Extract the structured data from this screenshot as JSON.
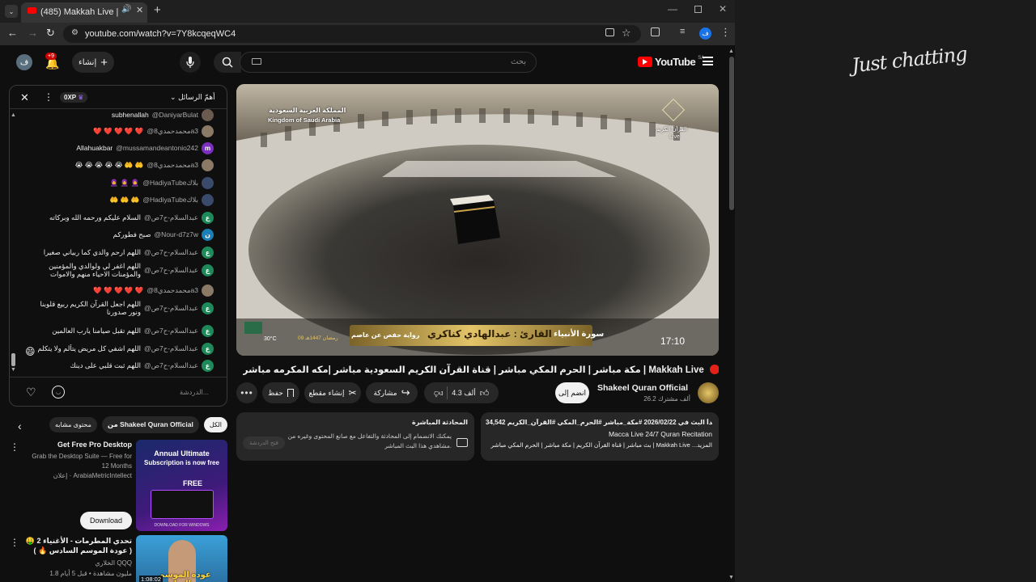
{
  "browser": {
    "tab_title": "(485) Makkah Live | مكة",
    "url": "youtube.com/watch?v=7Y8kcqeqWC4"
  },
  "header": {
    "logo": "YouTube",
    "region": "SA",
    "search_placeholder": "بحث",
    "create_label": "إنشاء",
    "notif_count": "+9",
    "avatar_letter": "ف"
  },
  "chat": {
    "header_title": "أهمّ الرسائل",
    "points": "0XP",
    "messages": [
      {
        "author": "@DaniyarBulat",
        "text": "subhenallah",
        "avatar": "",
        "color": "#6b5a4e"
      },
      {
        "author": "@محمدحمدي8a3",
        "text": "❤️ ❤️ ❤️ ❤️ ❤️",
        "avatar": "",
        "color": "#8a7a66"
      },
      {
        "author": "@mussamandeantonio242",
        "text": "Allahuakbar",
        "avatar": "m",
        "color": "#7b2fbe"
      },
      {
        "author": "@محمدحمدي8a3",
        "text": "😭 😭 😭 😭 😭 🤲 🤲",
        "avatar": "",
        "color": "#8a7a66"
      },
      {
        "author": "@HadiyaTubeبلاك",
        "text": "🧕 🧕 🧕",
        "avatar": "",
        "color": "#3a4a6a"
      },
      {
        "author": "@HadiyaTubeبلاك",
        "text": "🤲 🤲 🤲",
        "avatar": "",
        "color": "#3a4a6a"
      },
      {
        "author": "@عبدالسلام-ح7ص",
        "text": "السلام عليكم ورحمه الله وبركاته",
        "avatar": "ع",
        "color": "#1e8a5a"
      },
      {
        "author": "@Nour-d7z7w",
        "text": "صبح فطوركم",
        "avatar": "ن",
        "color": "#1a7fb5"
      },
      {
        "author": "@عبدالسلام-ح7ص",
        "text": "اللهم ارحم والدي كما ربياني صغيرا",
        "avatar": "ع",
        "color": "#1e8a5a"
      },
      {
        "author": "@عبدالسلام-ح7ص",
        "text": "اللهم اغفر لي ولوالدي والمؤمنين والمؤمنات الاحياء منهم والاموات",
        "avatar": "ع",
        "color": "#1e8a5a"
      },
      {
        "author": "@محمدحمدي8a3",
        "text": "❤️ ❤️ ❤️ ❤️ ❤️",
        "avatar": "",
        "color": "#8a7a66"
      },
      {
        "author": "@عبدالسلام-ح7ص",
        "text": "اللهم اجعل القرآن الكريم ربيع قلوبنا ونور صدورنا",
        "avatar": "ع",
        "color": "#1e8a5a"
      },
      {
        "author": "@عبدالسلام-ح7ص",
        "text": "اللهم تقبل صيامنا يارب العالمين",
        "avatar": "ع",
        "color": "#1e8a5a"
      },
      {
        "author": "@عبدالسلام-ح7ص",
        "text": "اللهم اشفي كل مريض يتألم ولا يتكلم",
        "avatar": "ع",
        "color": "#1e8a5a"
      },
      {
        "author": "@عبدالسلام-ح7ص",
        "text": "اللهم ثبت قلبي على دينك",
        "avatar": "ع",
        "color": "#1e8a5a"
      }
    ],
    "input_placeholder": "الدردشة..."
  },
  "video": {
    "overlay_country_ar": "المملكة العربية السعودية",
    "overlay_country_en": "Kingdom of Saudi Arabia",
    "overlay_channel_ar": "القرآن الكريم",
    "overlay_live": "Live",
    "surah": "سورة الأنبياء",
    "reciter": "القارئ : عبدالهادي كناكري",
    "riwaya": "رواية حفص عن عاصم",
    "hijri": "09 رمضان 1447هـ",
    "temp": "30°C",
    "time": "17:10",
    "title": "مكة مباشر | الحرم المكي مباشر | قناة القرآن الكريم السعودية مباشر |مكه المكرمه مباشر | Makkah Live",
    "channel": "Shakeel Quran Official",
    "subscribers": "26.2 ألف مشترك",
    "join_label": "انضم إلى",
    "likes": "4.3 ألف",
    "share": "مشاركة",
    "clip": "إنشاء مقطع",
    "save": "حفظ"
  },
  "description": {
    "stats": "34,542 مشاهدًا حاليًا  بدأ البث في 2026/02/22  #مكة_مباشر #الحرم_المكي #القرآن_الكريم",
    "line2": "Macca Live 24/7 Quran Recitation",
    "line3": "بث مباشر | قناة القرآن الكريم  |  مكة مباشر | الحرم المكي مباشر | Makkah Live ...المزيد"
  },
  "livechat_card": {
    "title": "المحادثة المباشرة",
    "body": "يمكنك الانضمام إلى المحادثة والتفاعل مع صانع المحتوى وغيره من مشاهدي هذا البث المباشر.",
    "button": "فتح الدردشة"
  },
  "chips": [
    "الكل",
    "من Shakeel Quran Official",
    "محتوى مشابه"
  ],
  "ad": {
    "title": "Get Free Pro Desktop",
    "desc": "Grab the Desktop Suite — Free for 12 Months",
    "sponsor": "إعلان · ArabiaMetricIntellect",
    "cta": "Download",
    "thumb_line1": "Annual Ultimate",
    "thumb_line2": "Subscription is now free",
    "thumb_price": "FREE",
    "thumb_footer": "DOWNLOAD FOR WINDOWS"
  },
  "reco": {
    "title": "تحدي المطرمات - الأغنياء 2 🤑 ( عودة الموسم السادس 🔥 )",
    "channel": "الخلاري QQQ",
    "meta": "1.8 مليون مشاهدة • قبل 5 أيام",
    "duration": "1:08:02",
    "thumb_text": "عودة الموسم السادس"
  },
  "right_panel": {
    "signature": "Just chatting"
  },
  "colors": {
    "yt_red": "#ff0000",
    "gold_banner": "#c9a24a",
    "live_red": "#e62117"
  }
}
